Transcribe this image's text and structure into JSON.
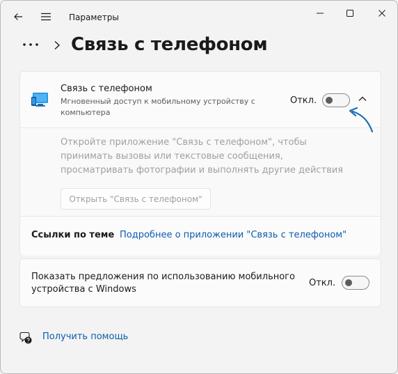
{
  "window": {
    "title": "Параметры"
  },
  "icons": {
    "back": "back-arrow-icon",
    "menu": "hamburger-menu-icon",
    "minimize": "minimize-icon",
    "maximize": "maximize-icon",
    "close": "close-icon",
    "more": "more-dots-icon",
    "breadcrumb_chevron": "chevron-right-icon",
    "phone_link": "phone-link-icon",
    "collapse": "chevron-up-icon",
    "help": "help-chat-icon"
  },
  "header": {
    "title": "Связь с телефоном"
  },
  "phone_link_setting": {
    "title": "Связь с телефоном",
    "description": "Мгновенный доступ к мобильному устройству с компьютера",
    "state_label": "Откл.",
    "toggle_on": false,
    "expanded": true,
    "body_text": "Откройте приложение \"Связь с телефоном\", чтобы принимать вызовы или текстовые сообщения, просматривать фотографии и выполнять другие действия",
    "open_button_label": "Открыть \"Связь с телефоном\""
  },
  "related_links": {
    "label": "Ссылки по теме",
    "link_text": "Подробнее о приложении \"Связь с телефоном\""
  },
  "suggestions_setting": {
    "text": "Показать предложения по использованию мобильного устройства с Windows",
    "state_label": "Откл.",
    "toggle_on": false
  },
  "help": {
    "link_text": "Получить помощь"
  },
  "colors": {
    "background": "#f3f3f3",
    "card": "#fbfbfb",
    "link": "#0b5cad",
    "annotation_arrow": "#1a6fb5",
    "disabled_text": "#a0a0a0"
  }
}
